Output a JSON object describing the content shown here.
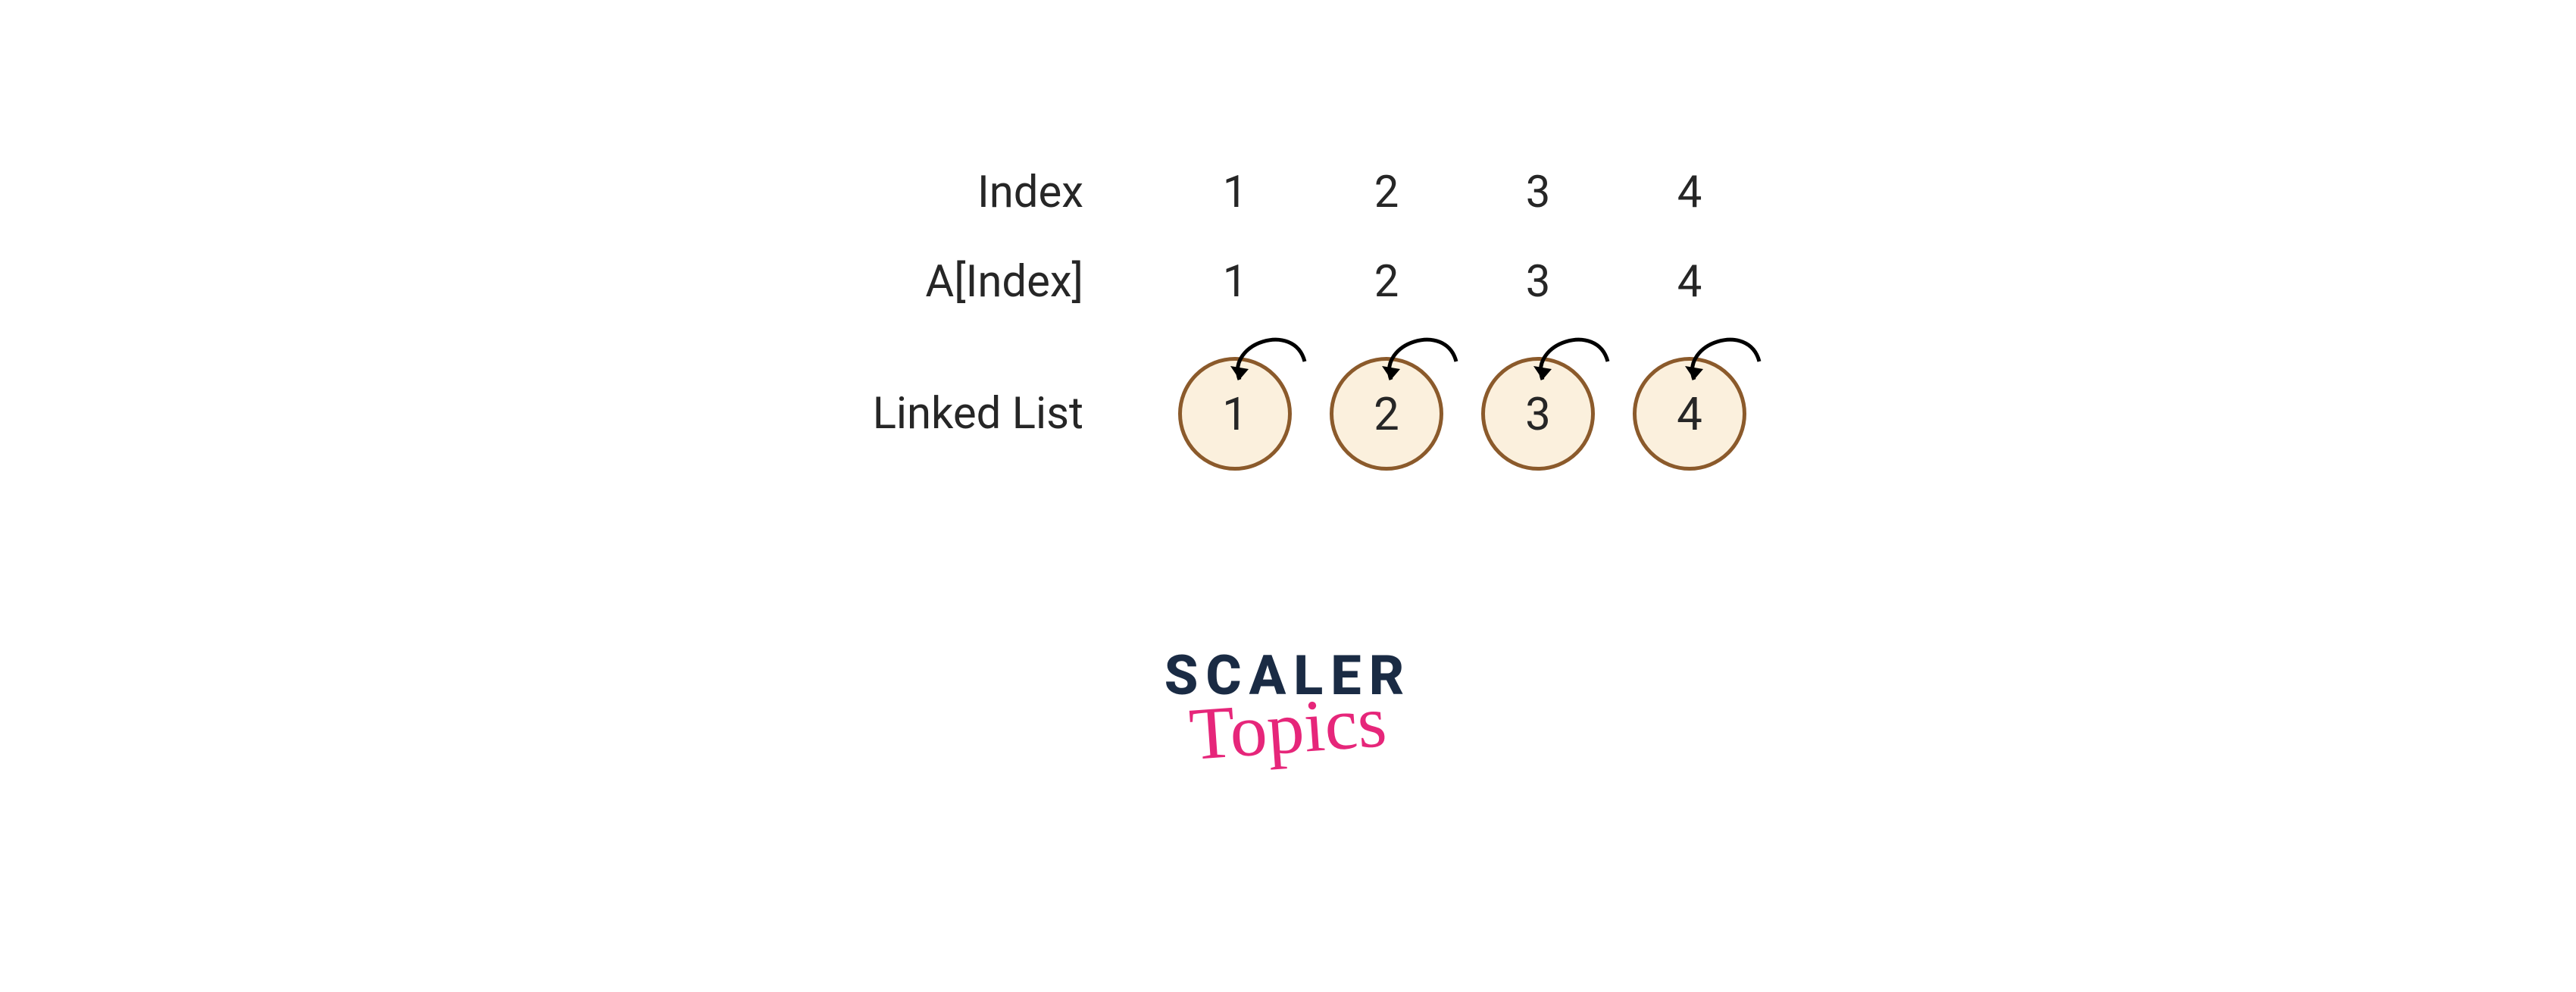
{
  "labels": {
    "index": "Index",
    "aindex": "A[Index]",
    "linked": "Linked List"
  },
  "index_values": [
    "1",
    "2",
    "3",
    "4"
  ],
  "aindex_values": [
    "1",
    "2",
    "3",
    "4"
  ],
  "nodes": [
    "1",
    "2",
    "3",
    "4"
  ],
  "logo": {
    "top": "SCALER",
    "bottom": "Topics"
  },
  "colors": {
    "node_fill": "#fbf0dd",
    "node_border": "#8b5a2b",
    "logo_top": "#1a2b44",
    "logo_bottom": "#e6267a"
  }
}
